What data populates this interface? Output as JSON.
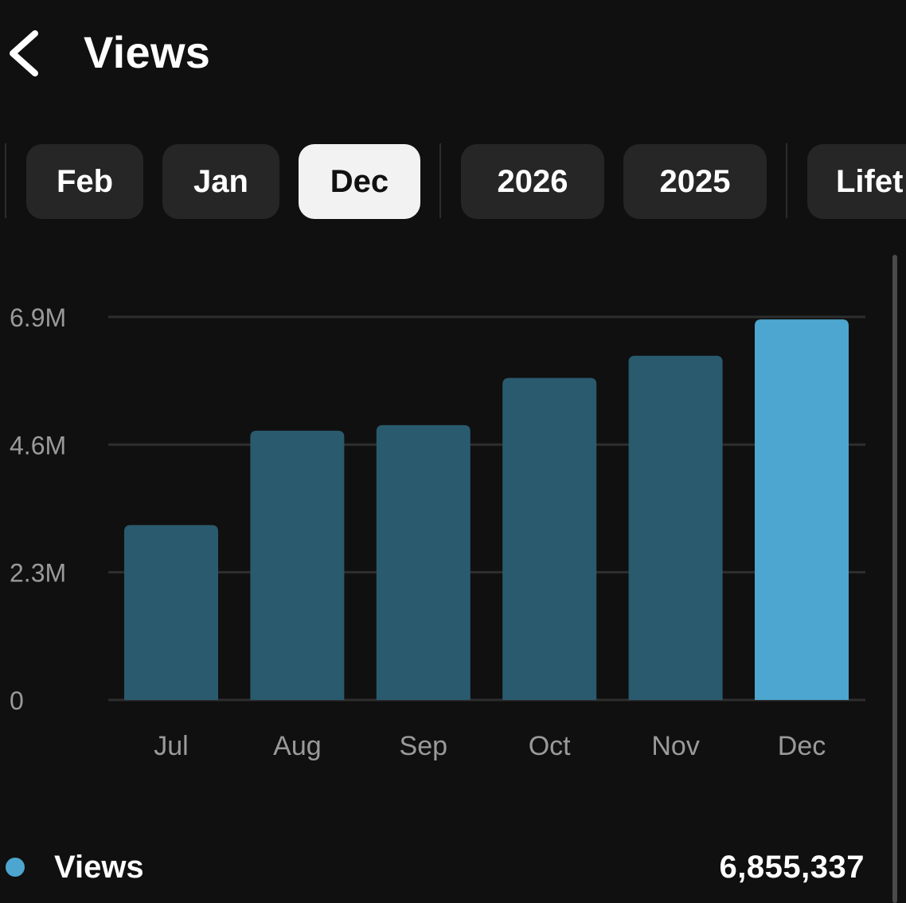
{
  "header": {
    "back_icon": "chevron-left-icon",
    "title": "Views"
  },
  "periods": [
    {
      "label": "Feb",
      "active": false
    },
    {
      "label": "Jan",
      "active": false
    },
    {
      "label": "Dec",
      "active": true
    },
    {
      "label": "2026",
      "active": false
    },
    {
      "label": "2025",
      "active": false
    },
    {
      "label": "Lifet",
      "active": false
    }
  ],
  "chart_data": {
    "type": "bar",
    "categories": [
      "Jul",
      "Aug",
      "Sep",
      "Oct",
      "Nov",
      "Dec"
    ],
    "values": [
      3150000,
      4850000,
      4950000,
      5800000,
      6200000,
      6855337
    ],
    "highlighted": "Dec",
    "yticks": [
      {
        "value": 0,
        "label": "0"
      },
      {
        "value": 2300000,
        "label": "2.3M"
      },
      {
        "value": 4600000,
        "label": "4.6M"
      },
      {
        "value": 6900000,
        "label": "6.9M"
      }
    ],
    "ylim": [
      0,
      6900000
    ],
    "grid": true,
    "colors": {
      "bar": "#2a5a6e",
      "highlight": "#4ca6cf",
      "grid": "#2e2e2e"
    }
  },
  "legend": {
    "label": "Views",
    "value": "6,855,337",
    "color": "#4ca6cf"
  }
}
